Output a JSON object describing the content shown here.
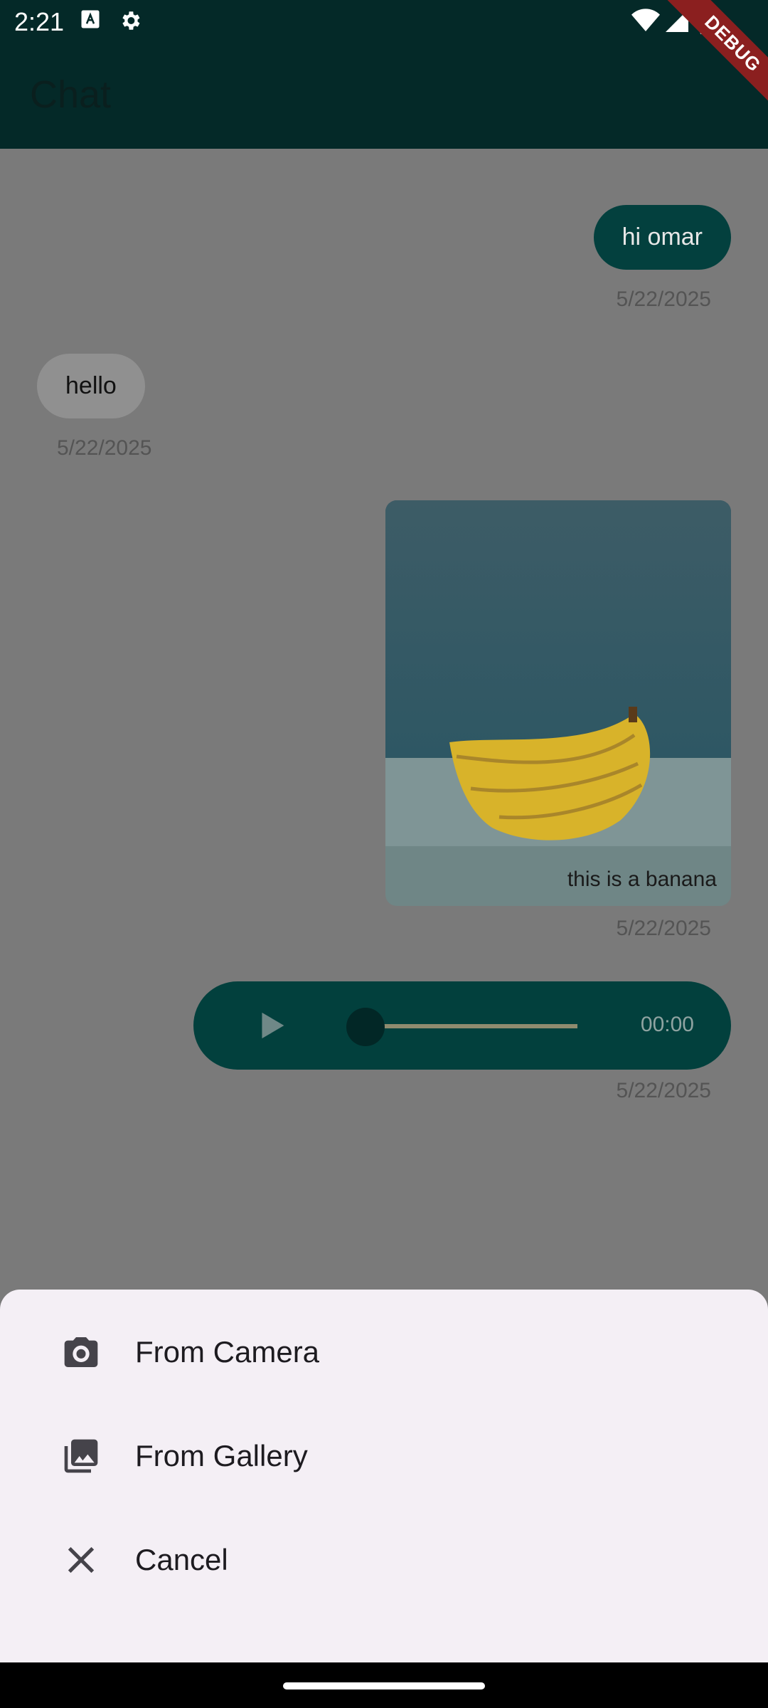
{
  "status_bar": {
    "time": "2:21",
    "icons": [
      "text-a-icon",
      "settings-gear-icon",
      "wifi-icon",
      "signal-icon",
      "battery-icon"
    ]
  },
  "debug_banner": "DEBUG",
  "app_bar": {
    "title": "Chat"
  },
  "messages": [
    {
      "type": "text",
      "direction": "out",
      "text": "hi omar",
      "timestamp": "5/22/2025"
    },
    {
      "type": "text",
      "direction": "in",
      "text": "hello",
      "timestamp": "5/22/2025"
    },
    {
      "type": "image",
      "direction": "out",
      "caption": "this is a banana",
      "timestamp": "5/22/2025"
    },
    {
      "type": "audio",
      "direction": "out",
      "duration": "00:00",
      "timestamp": "5/22/2025"
    }
  ],
  "bottom_sheet": {
    "items": [
      {
        "label": "From Camera",
        "icon": "camera-icon"
      },
      {
        "label": "From Gallery",
        "icon": "gallery-icon"
      },
      {
        "label": "Cancel",
        "icon": "close-icon"
      }
    ]
  },
  "colors": {
    "app_bar": "#042928",
    "outgoing_bubble": "#03403e",
    "incoming_bubble": "#909090",
    "sheet_bg": "#f4eff5",
    "scrim": "#7a7a7a"
  }
}
